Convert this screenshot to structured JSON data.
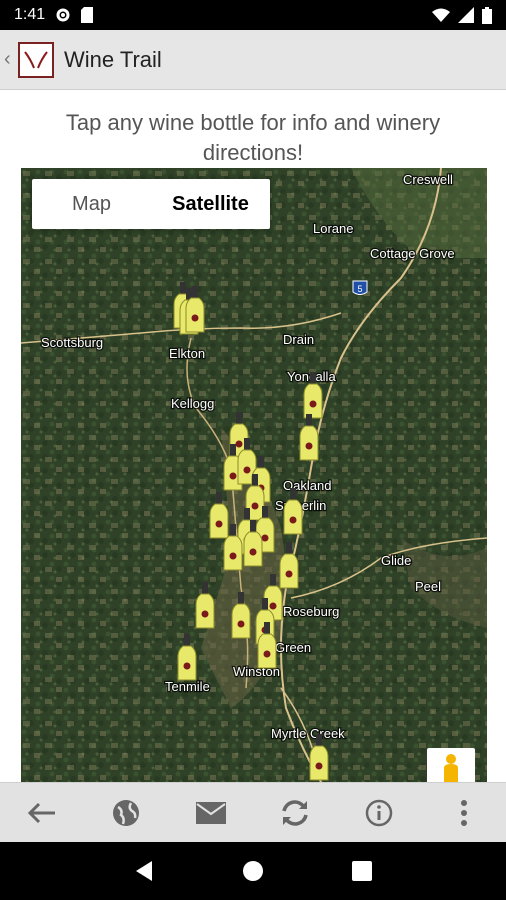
{
  "status_bar": {
    "time": "1:41"
  },
  "app_bar": {
    "title": "Wine Trail"
  },
  "instruction": "Tap any wine bottle for info and winery directions!",
  "map": {
    "type_toggle": {
      "map_label": "Map",
      "satellite_label": "Satellite",
      "selected": "Satellite"
    },
    "places": [
      "Creswell",
      "Lorane",
      "Cottage Grove",
      "Scottsburg",
      "Drain",
      "Elkton",
      "Yoncalla",
      "Kellogg",
      "Oakland",
      "Sutherlin",
      "Glide",
      "Peel",
      "Roseburg",
      "Green",
      "Winston",
      "Tenmile",
      "Myrtle Creek"
    ],
    "highway_shield": "5",
    "colors": {
      "satellite_base": "#34452b",
      "bottle": "#e8e86a",
      "road": "#d8c18a"
    }
  },
  "bottom_bar": {
    "icons": [
      "back-arrow-icon",
      "globe-icon",
      "mail-icon",
      "refresh-icon",
      "info-icon",
      "more-vert-icon"
    ]
  }
}
